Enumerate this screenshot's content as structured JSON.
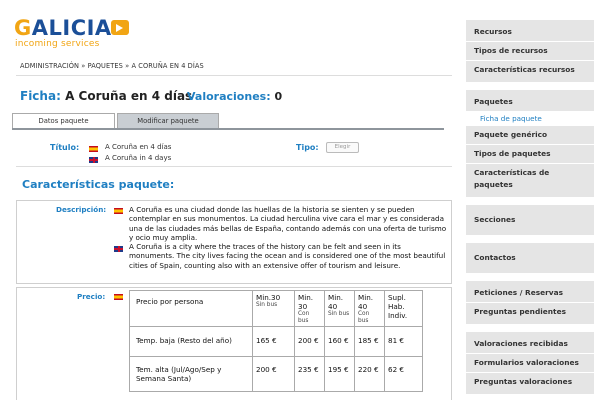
{
  "brand": {
    "name": "GALICIA",
    "subtitle": "incoming services"
  },
  "breadcrumb": "ADMINISTRACIÓN » PAQUETES » A CORUÑA EN 4 DÍAS",
  "ficha": {
    "label": "Ficha:",
    "name": "A Coruña en 4 días",
    "val_label": "Valoraciones:",
    "val_count": "0"
  },
  "tabs": {
    "active": "Datos paquete",
    "inactive": "Modificar paquete"
  },
  "titulo": {
    "label": "Título:",
    "es": "A Coruña en 4 días",
    "en": "A Coruña in 4 days"
  },
  "tipo": {
    "label": "Tipo:",
    "button": "Elegir"
  },
  "caracteristicas_title": "Características paquete:",
  "descripcion": {
    "label": "Descripción:",
    "es": "A Coruña es una ciudad donde las huellas de la historia se sienten y se pueden contemplar en sus monumentos. La ciudad herculina vive cara el mar y es considerada una de las ciudades más bellas de España, contando además con una oferta de turismo y ocio muy amplia.",
    "en": "A Coruña is a city where the traces of the history can be felt and seen in its monuments. The city lives facing the ocean and is considered one of the most beautiful cities of Spain, counting also with an extensive offer of tourism and leisure."
  },
  "precio": {
    "label": "Precio:",
    "headers": [
      {
        "main": "Precio por persona",
        "sub": ""
      },
      {
        "main": "Min.30",
        "sub": "Sin bus"
      },
      {
        "main": "Min. 30",
        "sub": "Con bus"
      },
      {
        "main": "Min. 40",
        "sub": "Sin bus"
      },
      {
        "main": "Min. 40",
        "sub": "Con bus"
      },
      {
        "main": "Supl. Hab. Indiv.",
        "sub": ""
      }
    ],
    "rows": [
      [
        "Temp. baja (Resto del año)",
        "165 €",
        "200 €",
        "160 €",
        "185 €",
        "81 €"
      ],
      [
        "Tem. alta (Jul/Ago/Sep y Semana Santa)",
        "200 €",
        "235 €",
        "195 €",
        "220 €",
        "62 €"
      ]
    ]
  },
  "sidebar": {
    "groups": [
      {
        "items": [
          "Recursos",
          "Tipos de recursos",
          "Características recursos"
        ]
      },
      {
        "items": [
          "Paquetes",
          "Ficha de paquete",
          "Paquete genérico",
          "Tipos de paquetes",
          "Características de paquetes"
        ]
      },
      {
        "items": [
          "Secciones"
        ]
      },
      {
        "items": [
          "Contactos"
        ]
      },
      {
        "items": [
          "Peticiones / Reservas",
          "Preguntas pendientes"
        ]
      },
      {
        "items": [
          "Valoraciones recibidas",
          "Formularios valoraciones",
          "Preguntas valoraciones"
        ]
      }
    ]
  },
  "colors": {
    "brand_blue": "#1b4f98",
    "brand_orange": "#f1a514",
    "label_blue": "#1f7fc2"
  }
}
